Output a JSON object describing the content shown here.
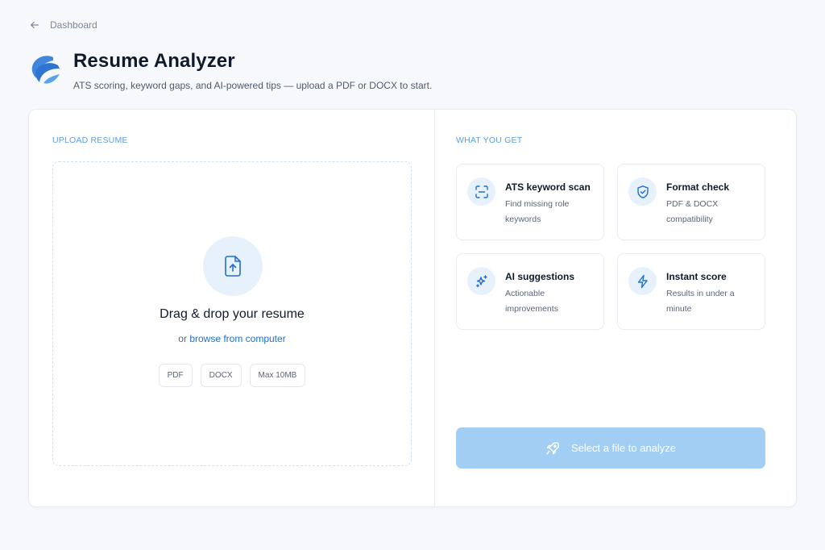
{
  "nav": {
    "back_label": "Dashboard"
  },
  "header": {
    "title": "Resume Analyzer",
    "subtitle": "ATS scoring, keyword gaps, and AI-powered tips — upload a PDF or DOCX to start."
  },
  "upload": {
    "section_label": "UPLOAD RESUME",
    "drop_title": "Drag & drop your resume",
    "drop_prefix": "or",
    "browse_link": "browse from computer",
    "chips": [
      "PDF",
      "DOCX",
      "Max 10MB"
    ]
  },
  "features": {
    "section_label": "WHAT YOU GET",
    "items": [
      {
        "title": "ATS keyword scan",
        "description": "Find missing role keywords",
        "icon": "scan-icon"
      },
      {
        "title": "Format check",
        "description": "PDF & DOCX compatibility",
        "icon": "shield-check-icon"
      },
      {
        "title": "AI suggestions",
        "description": "Actionable improvements",
        "icon": "sparkles-icon"
      },
      {
        "title": "Instant score",
        "description": "Results in under a minute",
        "icon": "lightning-icon"
      }
    ]
  },
  "action": {
    "analyze_label": "Select a file to analyze",
    "icon": "rocket-icon",
    "disabled": true
  },
  "colors": {
    "accent": "#1e6fd0",
    "section_label": "#5a9de6",
    "icon_bg": "#e7f1fc",
    "button_disabled": "#a2cef4",
    "background": "#f6f8fb"
  }
}
